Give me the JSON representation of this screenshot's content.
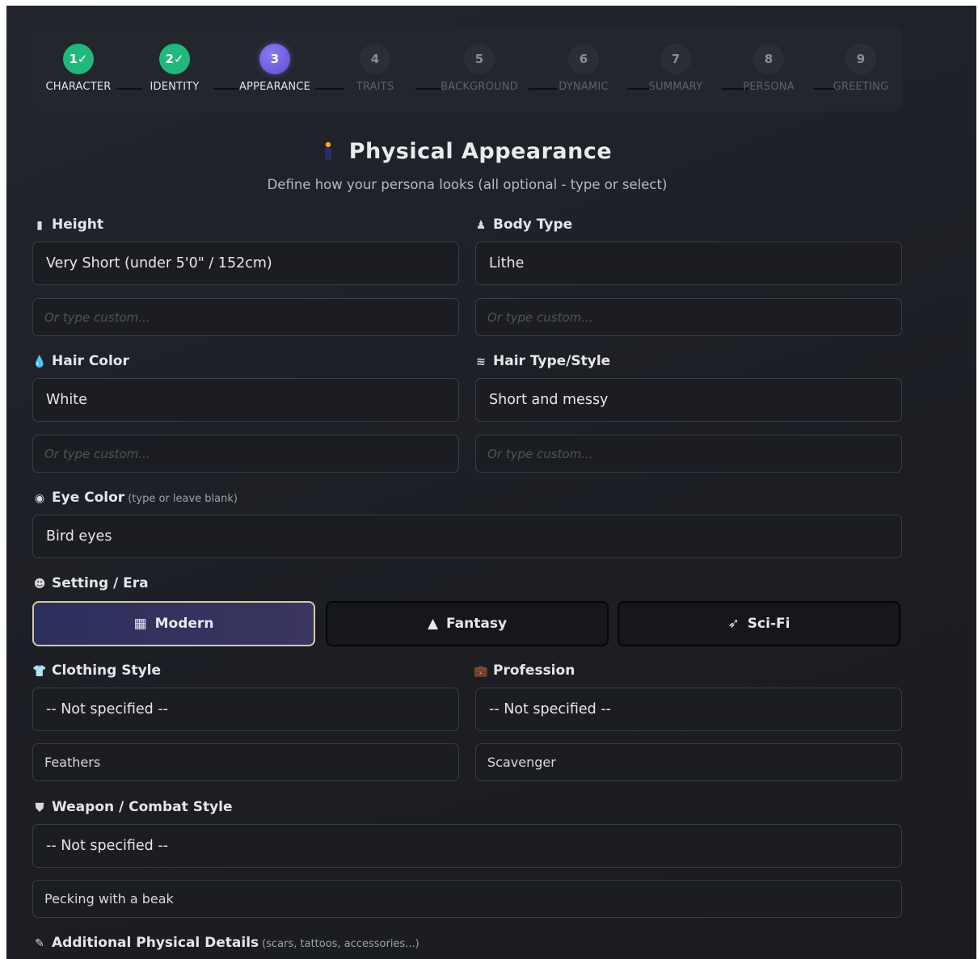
{
  "stepper": {
    "steps": [
      {
        "num": "1✓",
        "label": "CHARACTER",
        "state": "done"
      },
      {
        "num": "2✓",
        "label": "IDENTITY",
        "state": "done"
      },
      {
        "num": "3",
        "label": "APPEARANCE",
        "state": "active"
      },
      {
        "num": "4",
        "label": "TRAITS",
        "state": "pending"
      },
      {
        "num": "5",
        "label": "BACKGROUND",
        "state": "pending"
      },
      {
        "num": "6",
        "label": "DYNAMIC",
        "state": "pending"
      },
      {
        "num": "7",
        "label": "SUMMARY",
        "state": "pending"
      },
      {
        "num": "8",
        "label": "PERSONA",
        "state": "pending"
      },
      {
        "num": "9",
        "label": "GREETING",
        "state": "pending"
      }
    ]
  },
  "header": {
    "icon": "person-icon",
    "title": "Physical Appearance",
    "subtitle": "Define how your persona looks (all optional - type or select)"
  },
  "height": {
    "label": "Height",
    "icon": "ruler-icon",
    "selected": "Very Short (under 5'0\" / 152cm)",
    "custom_placeholder": "Or type custom..."
  },
  "body_type": {
    "label": "Body Type",
    "icon": "figure-icon",
    "selected": "Lithe",
    "custom_placeholder": "Or type custom..."
  },
  "hair_color": {
    "label": "Hair Color",
    "icon": "droplet-icon",
    "selected": "White",
    "custom_placeholder": "Or type custom..."
  },
  "hair_style": {
    "label": "Hair Type/Style",
    "icon": "wind-icon",
    "selected": "Short and messy",
    "custom_placeholder": "Or type custom..."
  },
  "eye_color": {
    "label": "Eye Color",
    "hint": "(type or leave blank)",
    "icon": "eye-icon",
    "value": "Bird eyes"
  },
  "setting": {
    "label": "Setting / Era",
    "icon": "masks-icon",
    "options": [
      {
        "label": "Modern",
        "icon": "city-icon",
        "selected": true
      },
      {
        "label": "Fantasy",
        "icon": "wizard-hat-icon",
        "selected": false
      },
      {
        "label": "Sci-Fi",
        "icon": "rocket-icon",
        "selected": false
      }
    ]
  },
  "clothing": {
    "label": "Clothing Style",
    "icon": "shirt-icon",
    "selected": "-- Not specified --",
    "custom_value": "Feathers"
  },
  "profession": {
    "label": "Profession",
    "icon": "briefcase-icon",
    "selected": "-- Not specified --",
    "custom_value": "Scavenger"
  },
  "weapon": {
    "label": "Weapon / Combat Style",
    "icon": "shield-icon",
    "selected": "-- Not specified --",
    "custom_value": "Pecking with a beak"
  },
  "additional": {
    "label": "Additional Physical Details",
    "hint": "(scars, tattoos, accessories...)",
    "icon": "pencil-icon"
  },
  "colors": {
    "done": "#21b87c",
    "active": "#6b5fe0",
    "accent_border": "#d8c9a0"
  }
}
